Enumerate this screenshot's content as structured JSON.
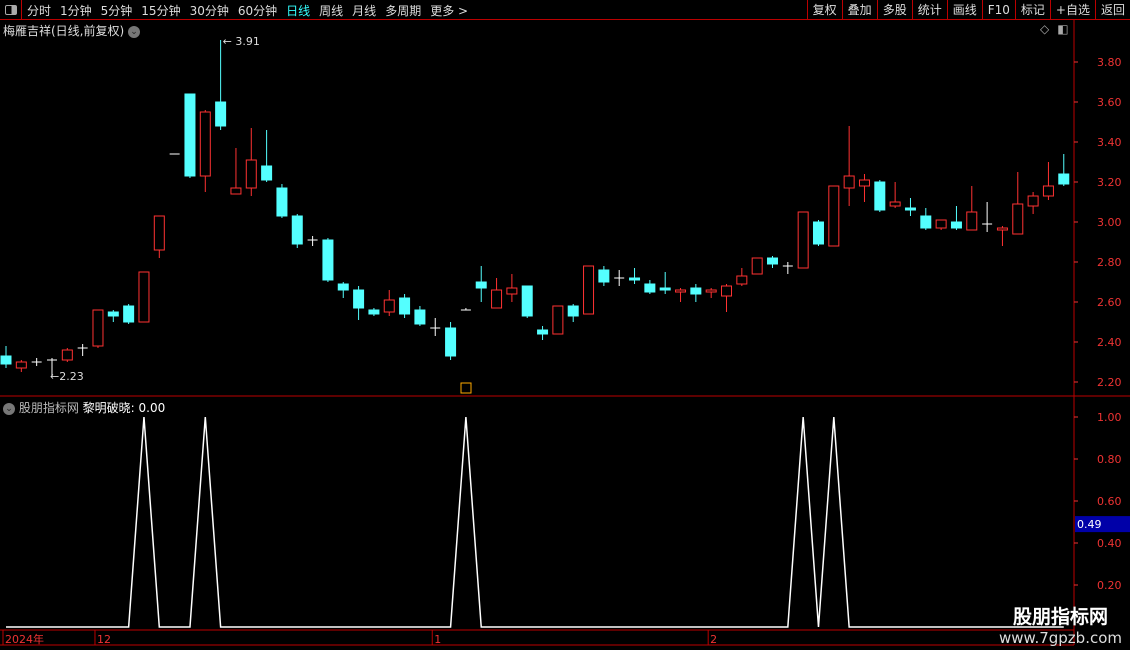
{
  "toolbar": {
    "periods": [
      "分时",
      "1分钟",
      "5分钟",
      "15分钟",
      "30分钟",
      "60分钟",
      "日线",
      "周线",
      "月线",
      "多周期",
      "更多 >"
    ],
    "active": "日线",
    "tools": [
      "复权",
      "叠加",
      "多股",
      "统计",
      "画线",
      "F10",
      "标记",
      "+自选",
      "返回"
    ]
  },
  "stock_title": "梅雁吉祥(日线,前复权)",
  "indicator": {
    "name": "股朋指标网",
    "line_label": "黎明破晓: 0.00",
    "current_marker": "0.49"
  },
  "watermark": {
    "line1": "股朋指标网",
    "line2": "www.7gpzb.com"
  },
  "colors": {
    "up": "#ff3232",
    "down": "#54ffff",
    "axis": "#e33",
    "indicator": "#ffffff",
    "marker_bg": "#0000a8"
  },
  "chart_data": [
    {
      "type": "candlestick",
      "ylim": [
        2.15,
        3.95
      ],
      "yticks": [
        "3.80",
        "3.60",
        "3.40",
        "3.20",
        "3.00",
        "2.80",
        "2.60",
        "2.40",
        "2.20"
      ],
      "annotations": {
        "high": "3.91",
        "low": "2.23"
      },
      "x_labels": [
        {
          "label": "2024年",
          "index": 0
        },
        {
          "label": "12",
          "index": 6
        },
        {
          "label": "1",
          "index": 28
        },
        {
          "label": "2",
          "index": 46
        }
      ],
      "candles": [
        [
          2.33,
          2.29,
          2.38,
          2.27
        ],
        [
          2.27,
          2.3,
          2.31,
          2.25
        ],
        [
          2.3,
          2.3,
          2.32,
          2.28
        ],
        [
          2.31,
          2.31,
          2.32,
          2.23
        ],
        [
          2.31,
          2.36,
          2.37,
          2.3
        ],
        [
          2.37,
          2.37,
          2.39,
          2.33
        ],
        [
          2.38,
          2.56,
          2.56,
          2.37
        ],
        [
          2.55,
          2.53,
          2.56,
          2.5
        ],
        [
          2.58,
          2.5,
          2.59,
          2.49
        ],
        [
          2.5,
          2.75,
          2.75,
          2.5
        ],
        [
          2.86,
          3.03,
          3.03,
          2.82
        ],
        [
          3.34,
          3.34,
          3.34,
          3.34
        ],
        [
          3.64,
          3.23,
          3.64,
          3.22
        ],
        [
          3.23,
          3.55,
          3.56,
          3.15
        ],
        [
          3.6,
          3.48,
          3.91,
          3.46
        ],
        [
          3.14,
          3.17,
          3.37,
          3.14
        ],
        [
          3.17,
          3.31,
          3.47,
          3.13
        ],
        [
          3.28,
          3.21,
          3.46,
          3.2
        ],
        [
          3.17,
          3.03,
          3.19,
          3.02
        ],
        [
          3.03,
          2.89,
          3.04,
          2.87
        ],
        [
          2.91,
          2.91,
          2.93,
          2.88
        ],
        [
          2.91,
          2.71,
          2.92,
          2.7
        ],
        [
          2.69,
          2.66,
          2.7,
          2.62
        ],
        [
          2.66,
          2.57,
          2.68,
          2.51
        ],
        [
          2.56,
          2.54,
          2.57,
          2.53
        ],
        [
          2.55,
          2.61,
          2.66,
          2.53
        ],
        [
          2.62,
          2.54,
          2.64,
          2.52
        ],
        [
          2.56,
          2.49,
          2.58,
          2.48
        ],
        [
          2.47,
          2.47,
          2.52,
          2.43
        ],
        [
          2.47,
          2.33,
          2.5,
          2.31
        ],
        [
          2.56,
          2.56,
          2.57,
          2.56
        ],
        [
          2.7,
          2.67,
          2.78,
          2.6
        ],
        [
          2.57,
          2.66,
          2.72,
          2.57
        ],
        [
          2.64,
          2.67,
          2.74,
          2.6
        ],
        [
          2.68,
          2.53,
          2.68,
          2.52
        ],
        [
          2.46,
          2.44,
          2.48,
          2.41
        ],
        [
          2.44,
          2.58,
          2.58,
          2.44
        ],
        [
          2.58,
          2.53,
          2.59,
          2.5
        ],
        [
          2.54,
          2.78,
          2.78,
          2.54
        ],
        [
          2.76,
          2.7,
          2.78,
          2.68
        ],
        [
          2.72,
          2.72,
          2.76,
          2.68
        ],
        [
          2.72,
          2.71,
          2.77,
          2.69
        ],
        [
          2.69,
          2.65,
          2.71,
          2.64
        ],
        [
          2.67,
          2.66,
          2.75,
          2.64
        ],
        [
          2.65,
          2.66,
          2.67,
          2.6
        ],
        [
          2.67,
          2.64,
          2.69,
          2.6
        ],
        [
          2.65,
          2.66,
          2.67,
          2.62
        ],
        [
          2.63,
          2.68,
          2.69,
          2.55
        ],
        [
          2.69,
          2.73,
          2.77,
          2.68
        ],
        [
          2.74,
          2.82,
          2.82,
          2.74
        ],
        [
          2.82,
          2.79,
          2.83,
          2.77
        ],
        [
          2.78,
          2.78,
          2.8,
          2.74
        ],
        [
          2.77,
          3.05,
          3.05,
          2.77
        ],
        [
          3.0,
          2.89,
          3.01,
          2.88
        ],
        [
          2.88,
          3.18,
          3.18,
          2.88
        ],
        [
          3.17,
          3.23,
          3.48,
          3.08
        ],
        [
          3.18,
          3.21,
          3.24,
          3.1
        ],
        [
          3.2,
          3.06,
          3.21,
          3.05
        ],
        [
          3.08,
          3.1,
          3.2,
          3.07
        ],
        [
          3.07,
          3.06,
          3.12,
          3.03
        ],
        [
          3.03,
          2.97,
          3.07,
          2.96
        ],
        [
          2.97,
          3.01,
          3.01,
          2.96
        ],
        [
          3.0,
          2.97,
          3.08,
          2.96
        ],
        [
          2.96,
          3.05,
          3.18,
          2.96
        ],
        [
          2.99,
          2.99,
          3.1,
          2.95
        ],
        [
          2.96,
          2.97,
          2.98,
          2.88
        ],
        [
          2.94,
          3.09,
          3.25,
          2.94
        ],
        [
          3.08,
          3.13,
          3.15,
          3.04
        ],
        [
          3.13,
          3.18,
          3.3,
          3.11
        ],
        [
          3.24,
          3.19,
          3.34,
          3.18
        ]
      ]
    },
    {
      "type": "line",
      "name": "黎明破晓",
      "ylim": [
        0,
        1.05
      ],
      "yticks": [
        "1.00",
        "0.80",
        "0.60",
        "0.40",
        "0.20"
      ],
      "spikes_at": [
        9,
        13,
        30,
        52,
        54
      ]
    }
  ]
}
